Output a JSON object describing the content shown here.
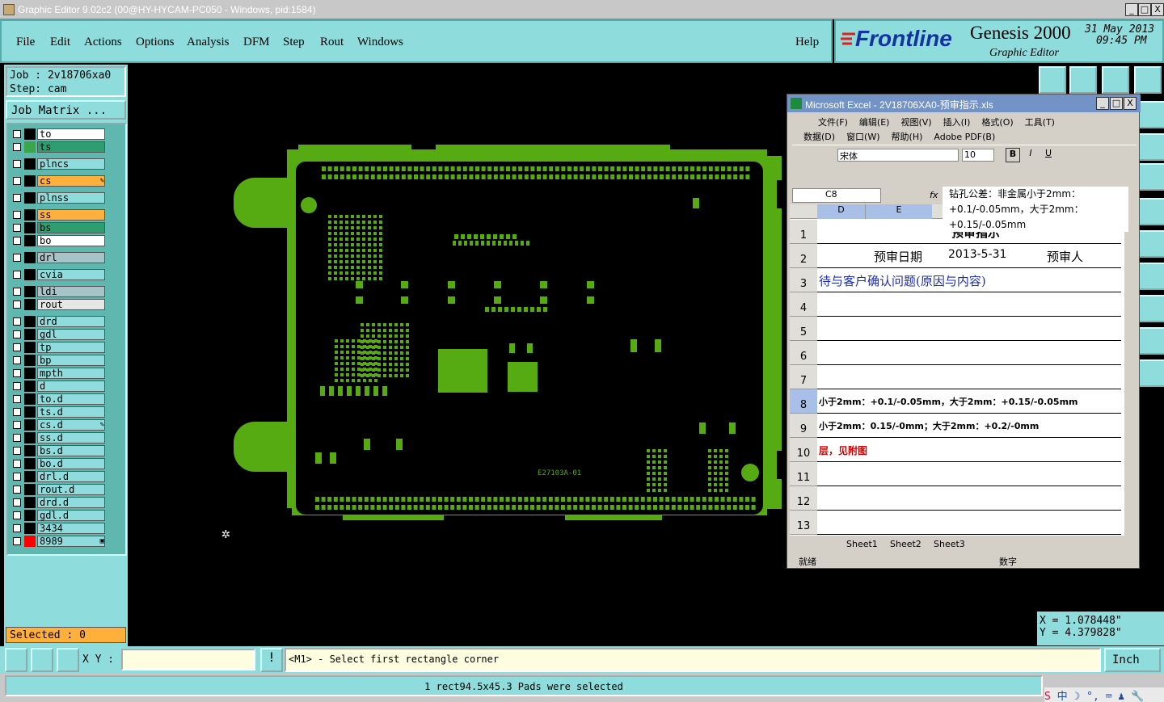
{
  "window": {
    "title": "Graphic Editor 9.02c2 (00@HY-HYCAM-PC050 - Windows, pid:1584)",
    "min": "_",
    "max": "□",
    "close": "X"
  },
  "menu": {
    "items": [
      "File",
      "Edit",
      "Actions",
      "Options",
      "Analysis",
      "DFM",
      "Step",
      "Rout",
      "Windows"
    ],
    "help": "Help"
  },
  "brand": {
    "logo": "Frontline",
    "product": "Genesis 2000",
    "subtitle": "Graphic Editor",
    "date": "31 May 2013",
    "time": "09:45 PM"
  },
  "job": {
    "job": "Job : 2v18706xa0",
    "step": "Step: cam",
    "matrix": "Job Matrix ..."
  },
  "layers": [
    {
      "name": "to",
      "color": "#ffffff",
      "sw": "#000000"
    },
    {
      "name": "ts",
      "color": "#2e9e70",
      "sw": "#3aa54a"
    },
    {
      "name": "plncs",
      "color": "#8fdcdc",
      "sw": "#000000"
    },
    {
      "name": "cs",
      "color": "#ffb03c",
      "sw": "#000000",
      "mark": "✎"
    },
    {
      "name": "plnss",
      "color": "#8fdcdc",
      "sw": "#000000"
    },
    {
      "name": "ss",
      "color": "#ffb03c",
      "sw": "#000000"
    },
    {
      "name": "bs",
      "color": "#2e9e70",
      "sw": "#000000"
    },
    {
      "name": "bo",
      "color": "#ffffff",
      "sw": "#000000"
    },
    {
      "name": "drl",
      "color": "#a6c4c8",
      "sw": "#000000"
    },
    {
      "name": "cvia",
      "color": "#8fdcdc",
      "sw": "#000000"
    },
    {
      "name": "ldi",
      "color": "#a6c4c8",
      "sw": "#000000"
    },
    {
      "name": "rout",
      "color": "#e6e6e6",
      "sw": "#000000"
    },
    {
      "name": "drd",
      "color": "#8fdcdc",
      "sw": "#000000"
    },
    {
      "name": "gdl",
      "color": "#8fdcdc",
      "sw": "#000000"
    },
    {
      "name": "tp",
      "color": "#8fdcdc",
      "sw": "#000000"
    },
    {
      "name": "bp",
      "color": "#8fdcdc",
      "sw": "#000000"
    },
    {
      "name": "mpth",
      "color": "#8fdcdc",
      "sw": "#000000"
    },
    {
      "name": "d",
      "color": "#8fdcdc",
      "sw": "#000000"
    },
    {
      "name": "to.d",
      "color": "#8fdcdc",
      "sw": "#000000"
    },
    {
      "name": "ts.d",
      "color": "#8fdcdc",
      "sw": "#000000"
    },
    {
      "name": "cs.d",
      "color": "#8fdcdc",
      "sw": "#000000",
      "mark": "✎"
    },
    {
      "name": "ss.d",
      "color": "#8fdcdc",
      "sw": "#000000"
    },
    {
      "name": "bs.d",
      "color": "#8fdcdc",
      "sw": "#000000"
    },
    {
      "name": "bo.d",
      "color": "#8fdcdc",
      "sw": "#000000"
    },
    {
      "name": "drl.d",
      "color": "#8fdcdc",
      "sw": "#000000"
    },
    {
      "name": "rout.d",
      "color": "#8fdcdc",
      "sw": "#000000"
    },
    {
      "name": "drd.d",
      "color": "#8fdcdc",
      "sw": "#000000"
    },
    {
      "name": "gdl.d",
      "color": "#8fdcdc",
      "sw": "#000000"
    },
    {
      "name": "3434",
      "color": "#8fdcdc",
      "sw": "#000000"
    },
    {
      "name": "8989",
      "color": "#8fdcdc",
      "sw": "#ff0000",
      "mark": "▣"
    }
  ],
  "selected": "Selected : 0",
  "coords": {
    "x": "X = 1.078448\"",
    "y": "Y = 4.379828\""
  },
  "bottom": {
    "xy_label": "X Y :",
    "xy_value": "",
    "prompt": "<M1> - Select first rectangle corner",
    "units": "Inch",
    "status": "1 rect94.5x45.3 Pads were selected"
  },
  "board": {
    "silk": "E27103A-01"
  },
  "excel": {
    "title": "Microsoft Excel - 2V18706XA0-预审指示.xls",
    "menu1": [
      "文件(F)",
      "编辑(E)",
      "视图(V)",
      "插入(I)",
      "格式(O)",
      "工具(T)"
    ],
    "menu2": [
      "数据(D)",
      "窗口(W)",
      "帮助(H)",
      "Adobe PDF(B)"
    ],
    "font": "宋体",
    "size": "10",
    "bold": "B",
    "italic": "I",
    "underline": "U",
    "namebox": "C8",
    "fx": "fx",
    "tooltip": [
      "钻孔公差：非金属小于2mm：",
      "+0.1/-0.05mm，大于2mm：",
      "+0.15/-0.05mm"
    ],
    "cols": [
      "D",
      "E"
    ],
    "rows": [
      "1",
      "2",
      "3",
      "4",
      "5",
      "6",
      "7",
      "8",
      "9",
      "10",
      "11",
      "12",
      "13"
    ],
    "r1": "预审指示",
    "r2": [
      "预审日期",
      "2013-5-31",
      "预审人"
    ],
    "r3": "待与客户确认问题(原因与内容)",
    "r8": "小于2mm：+0.1/-0.05mm，大于2mm：+0.15/-0.05mm",
    "r9": "小于2mm：0.15/-0mm；大于2mm：+0.2/-0mm",
    "r10": "层，见附图",
    "sheets": [
      "Sheet1",
      "Sheet2",
      "Sheet3"
    ],
    "status_left": "就绪",
    "status_mid": "数字"
  },
  "tray": [
    "S",
    "中",
    "☽",
    "°,",
    "⌨",
    "♟",
    "🔧"
  ]
}
